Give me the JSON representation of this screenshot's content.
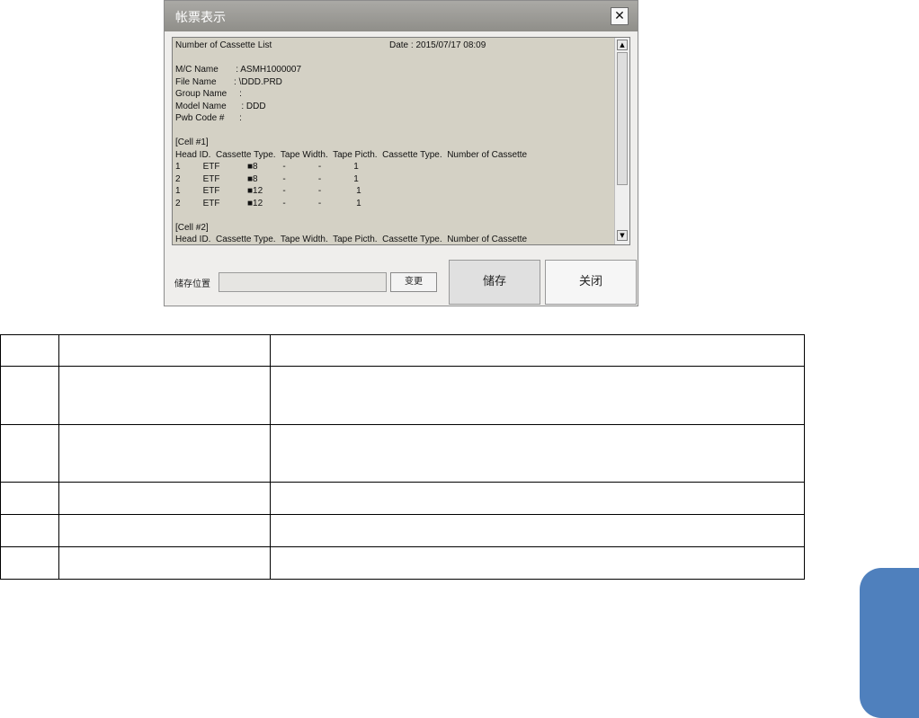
{
  "dialog": {
    "title": "帐票表示",
    "close_glyph": "✕",
    "report": {
      "lines": [
        "Number of Cassette List",
        "",
        "M/C Name       : ASMH1000007",
        "File Name       : \\DDD.PRD",
        "Group Name     :",
        "Model Name      : DDD",
        "Pwb Code #      :",
        "",
        "[Cell #1]",
        "Head ID.  Cassette Type.  Tape Width.  Tape Picth.  Cassette Type.  Number of Cassette",
        "1         ETF           ■8          -             -             1",
        "2         ETF           ■8          -             -             1",
        "1         ETF           ■12        -             -              1",
        "2         ETF           ■12        -             -              1",
        "",
        "[Cell #2]",
        "Head ID.  Cassette Type.  Tape Width.  Tape Picth.  Cassette Type.  Number of Cassette"
      ],
      "date": "Date : 2015/07/17 08:09"
    },
    "save_location_label": "储存位置",
    "save_location_value": "",
    "change_button": "变更",
    "save_button": "储存",
    "close_button": "关闭"
  },
  "colors": {
    "titlebar": "#9d9c97",
    "report_bg": "#d4d1c5",
    "side_tab": "#4f80bd"
  }
}
